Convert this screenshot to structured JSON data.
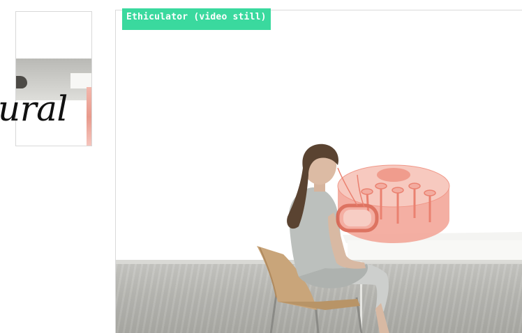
{
  "thumbnail": {
    "word": "ural"
  },
  "main_image": {
    "tag_label": "Ethiculator (video still)"
  }
}
